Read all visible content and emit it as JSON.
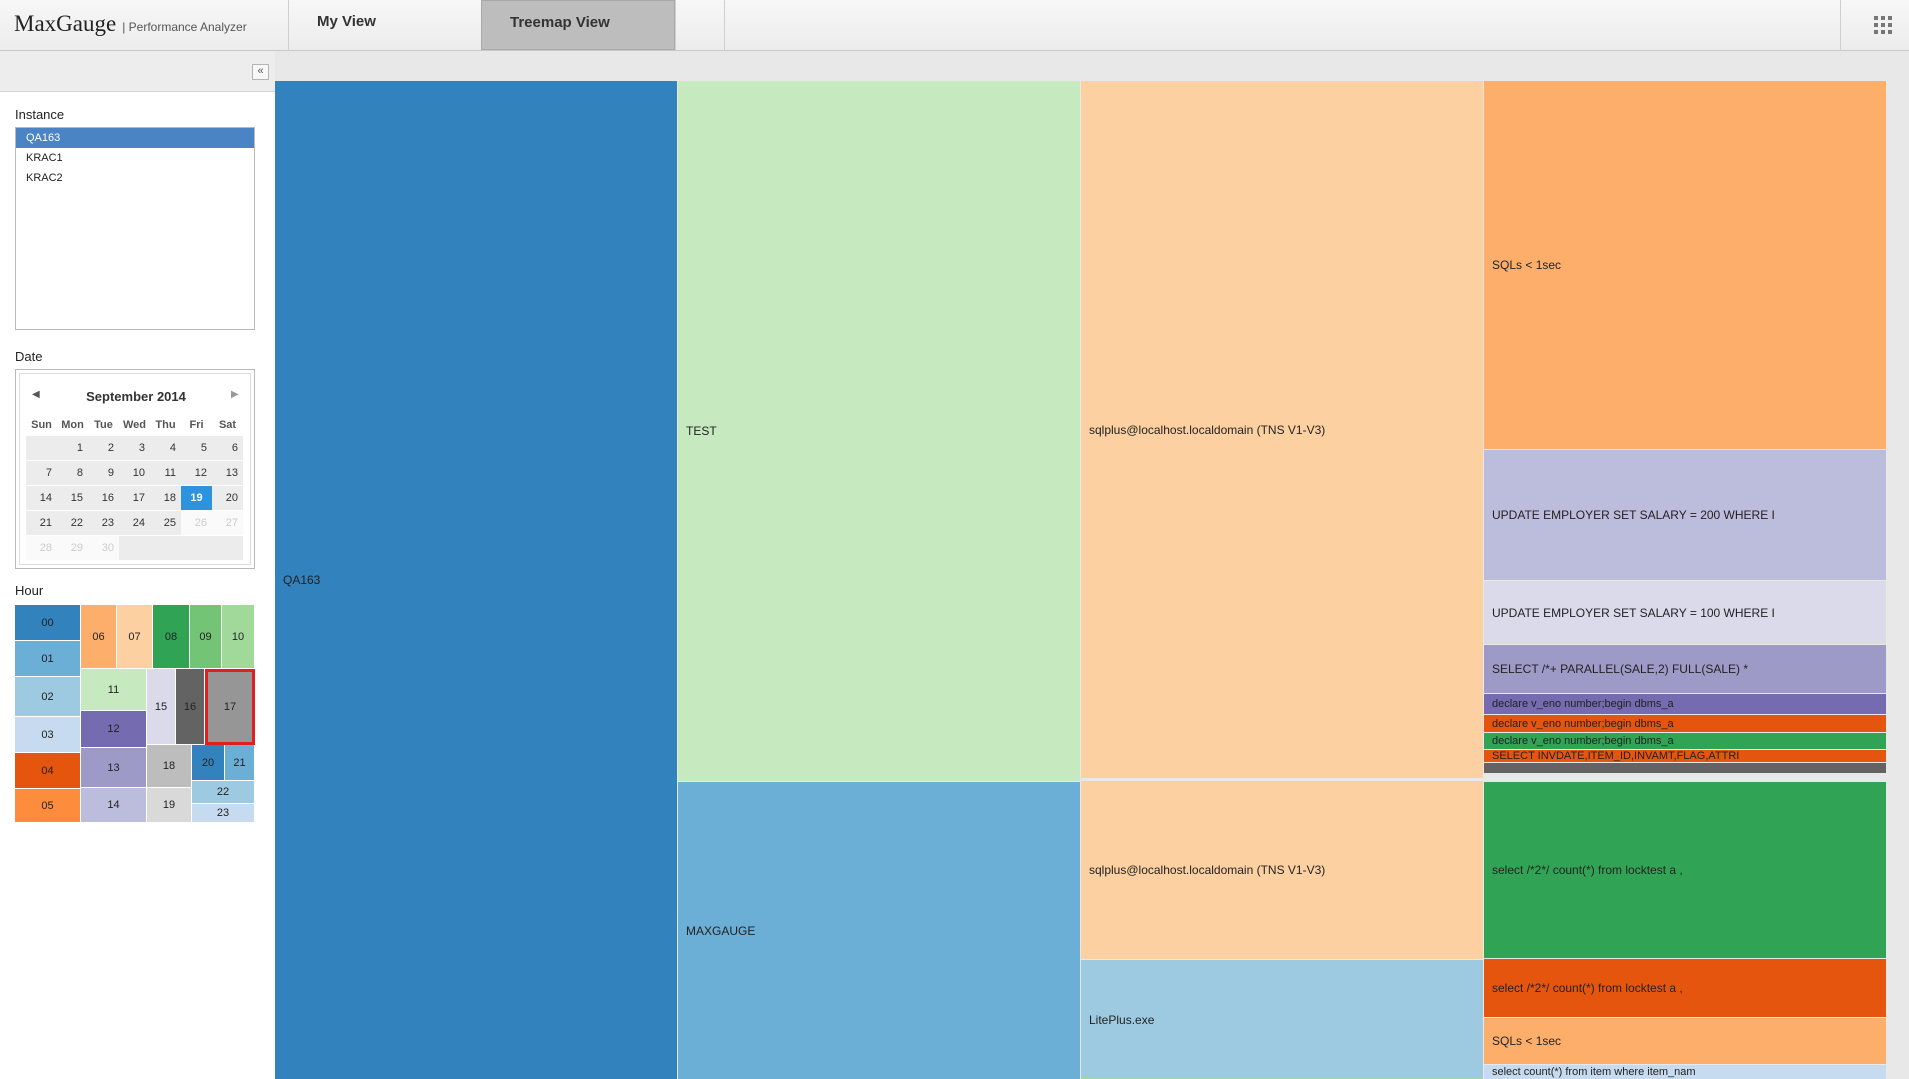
{
  "brand": {
    "name": "MaxGauge",
    "subtitle": "| Performance Analyzer"
  },
  "tabs": [
    {
      "label": "My View"
    },
    {
      "label": "Treemap View"
    }
  ],
  "sidebar": {
    "instance_label": "Instance",
    "instances": [
      "QA163",
      "KRAC1",
      "KRAC2"
    ],
    "date_label": "Date",
    "hour_label": "Hour",
    "collapse_symbol": "«"
  },
  "calendar": {
    "month": "September",
    "year": "2014",
    "weekdays": [
      "Sun",
      "Mon",
      "Tue",
      "Wed",
      "Thu",
      "Fri",
      "Sat"
    ],
    "weeks": [
      [
        "",
        "1",
        "2",
        "3",
        "4",
        "5",
        "6"
      ],
      [
        "7",
        "8",
        "9",
        "10",
        "11",
        "12",
        "13"
      ],
      [
        "14",
        "15",
        "16",
        "17",
        "18",
        "19",
        "20"
      ],
      [
        "21",
        "22",
        "23",
        "24",
        "25",
        "26",
        "27"
      ],
      [
        "28",
        "29",
        "30",
        "",
        "",
        "",
        ""
      ]
    ],
    "selected_day": "19",
    "muted_days": [
      "26",
      "27",
      "28",
      "29",
      "30"
    ]
  },
  "hours": {
    "values": [
      "00",
      "01",
      "02",
      "03",
      "04",
      "05",
      "06",
      "07",
      "08",
      "09",
      "10",
      "11",
      "12",
      "13",
      "14",
      "15",
      "16",
      "17",
      "18",
      "19",
      "20",
      "21",
      "22",
      "23"
    ],
    "selected": "17"
  },
  "treemap": {
    "instance": "QA163",
    "schemas": [
      {
        "name": "TEST",
        "color": "#c7e9c0"
      },
      {
        "name": "MAXGAUGE",
        "color": "#6baed6"
      }
    ],
    "programs": [
      {
        "name": "sqlplus@localhost.localdomain (TNS V1-V3)",
        "schema": "TEST",
        "color": "#fdd0a2"
      },
      {
        "name": "sqlplus@localhost.localdomain (TNS V1-V3)",
        "schema": "MAXGAUGE",
        "color": "#fdd0a2"
      },
      {
        "name": "LitePlus.exe",
        "schema": "MAXGAUGE",
        "color": "#9ecae1"
      }
    ],
    "sqls": [
      {
        "text": "SQLs < 1sec",
        "color": "#fdae6b"
      },
      {
        "text": "UPDATE EMPLOYER SET SALARY = 200 WHERE I",
        "color": "#bcbddc"
      },
      {
        "text": "UPDATE EMPLOYER SET SALARY = 100 WHERE I",
        "color": "#dadaeb"
      },
      {
        "text": "SELECT /*+ PARALLEL(SALE,2) FULL(SALE) *",
        "color": "#9e9ac8"
      },
      {
        "text": "declare v_eno number;begin dbms_a",
        "color": "#756bb1"
      },
      {
        "text": "declare v_eno number;begin dbms_a",
        "color": "#e6550d"
      },
      {
        "text": "declare v_eno number;begin dbms_a",
        "color": "#31a354"
      },
      {
        "text": "SELECT INVDATE,ITEM_ID,INVAMT,FLAG,ATTRI",
        "color": "#e6550d"
      },
      {
        "text": "select /*2*/ count(*) from locktest a ,",
        "color": "#31a354"
      },
      {
        "text": "select /*2*/ count(*) from locktest a ,",
        "color": "#e6550d"
      },
      {
        "text": "SQLs < 1sec",
        "color": "#fdae6b"
      },
      {
        "text": "select count(*) from item where item_nam",
        "color": "#c6dbef"
      }
    ],
    "instance_color": "#3182bd"
  }
}
